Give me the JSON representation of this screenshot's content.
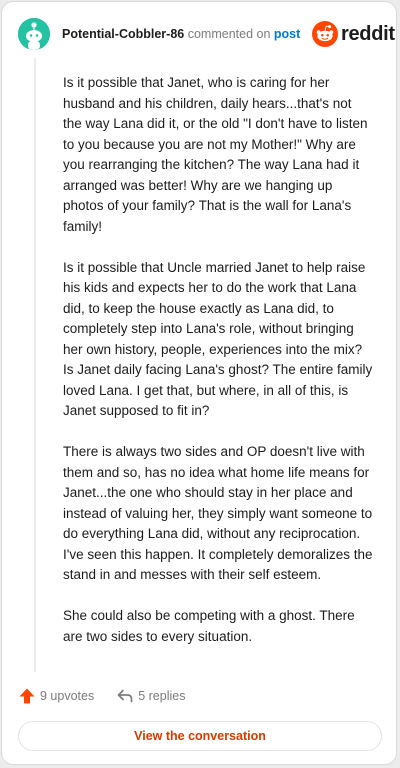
{
  "header": {
    "username": "Potential-Cobbler-86",
    "commented_on": "commented on",
    "post_link": "post",
    "brand": "reddit"
  },
  "comment": {
    "paragraphs": [
      "Is it possible that Janet, who is caring for her husband and his children, daily hears...that's not the way Lana did it, or the old \"I don't have to listen to you because you are not my Mother!\" Why are you rearranging the kitchen? The way Lana had it arranged was better! Why are we hanging up photos of your family? That is the wall for Lana's family!",
      "Is it possible that Uncle married Janet to help raise his kids and expects her to do the work that Lana did, to keep the house exactly as Lana did, to completely step into Lana's role, without bringing her own history, people, experiences into the mix? Is Janet daily facing Lana's ghost? The entire family loved Lana. I get that, but where, in all of this, is Janet supposed to fit in?",
      "There is always two sides and OP doesn't live with them and so, has no idea what home life means for Janet...the one who should stay in her place and instead of valuing her, they simply want someone to do everything Lana did, without any reciprocation. I've seen this happen. It completely demoralizes the stand in and messes with their self esteem.",
      "She could also be competing with a ghost. There are two sides to every situation."
    ]
  },
  "actions": {
    "upvotes": "9 upvotes",
    "replies": "5 replies"
  },
  "footer": {
    "view_conversation": "View the conversation"
  },
  "colors": {
    "avatar_bg": "#24c1a3",
    "brand_orange": "#ff4500",
    "link_blue": "#0079d3",
    "button_text": "#d93a00"
  },
  "icons": {
    "avatar": "snoo-avatar-icon",
    "brand": "reddit-logo-icon",
    "upvote": "upvote-arrow-icon",
    "reply": "reply-arrow-icon"
  }
}
